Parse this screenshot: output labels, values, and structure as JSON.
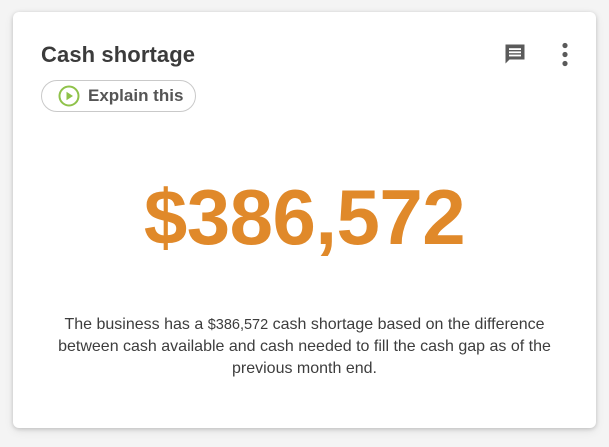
{
  "colors": {
    "accent": "#e0892a",
    "play_icon": "#8fc24a",
    "icon": "#5a5a5a"
  },
  "card": {
    "title": "Cash shortage",
    "explain_label": "Explain this",
    "icons": {
      "comment": "comment-list-icon",
      "more": "more-vertical-icon",
      "play": "play-circle-icon"
    },
    "value": "$386,572",
    "description": {
      "before": "The business has a ",
      "amount": "$386,572",
      "after": " cash shortage based on the difference between cash available and cash needed to fill the cash gap as of the previous month end."
    }
  }
}
